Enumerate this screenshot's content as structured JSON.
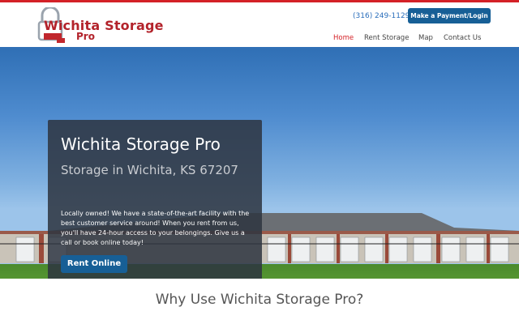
{
  "header": {
    "logo": {
      "line1": "Wichita Storage",
      "line2": "Pro"
    },
    "phone": "(316) 249-1129",
    "pay_button": "Make a Payment/Login",
    "nav": [
      {
        "label": "Home",
        "active": true
      },
      {
        "label": "Rent Storage",
        "active": false
      },
      {
        "label": "Map",
        "active": false
      },
      {
        "label": "Contact Us",
        "active": false
      }
    ]
  },
  "hero": {
    "title": "Wichita Storage Pro",
    "subtitle": "Storage in Wichita, KS 67207",
    "body": "Locally owned! We have a state-of-the-art facility with the best customer service around! When you rent from us, you'll have 24-hour access to your belongings. Give us a call or book online today!",
    "cta": "Rent Online"
  },
  "section": {
    "heading": "Why Use Wichita Storage Pro?"
  },
  "colors": {
    "accent": "#d42127",
    "button": "#175f96",
    "link": "#2a6ebb"
  }
}
